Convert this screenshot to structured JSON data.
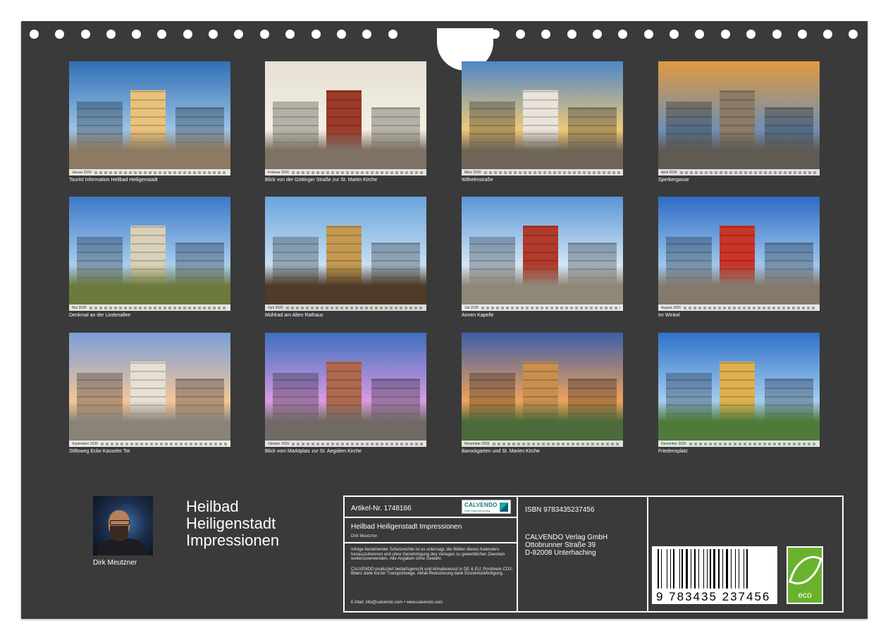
{
  "photos": [
    {
      "caption": "Tourist Information Heilbad Heiligenstadt",
      "month": "Januar 2026",
      "sky": [
        "#2f6fb4",
        "#9cc3e6"
      ],
      "ground": "#8d7a62",
      "accent": "#e8c27a"
    },
    {
      "caption": "Blick von der Göttinger Straße zur St. Martin Kirche",
      "month": "Februar 2026",
      "sky": [
        "#e6e1d2",
        "#f3efe2"
      ],
      "ground": "#7d7264",
      "accent": "#9b3b2a"
    },
    {
      "caption": "Wilhelmstraße",
      "month": "März 2026",
      "sky": [
        "#4d87c9",
        "#f0c878"
      ],
      "ground": "#6f6658",
      "accent": "#e9e3da"
    },
    {
      "caption": "Sperbergasse",
      "month": "April 2026",
      "sky": [
        "#e09a3e",
        "#6f8fb5"
      ],
      "ground": "#5f5a52",
      "accent": "#8b7b68"
    },
    {
      "caption": "Denkmal an der Lindenallee",
      "month": "Mai 2026",
      "sky": [
        "#3c78c8",
        "#a8cdee"
      ],
      "ground": "#6d7a3e",
      "accent": "#d8d0b8"
    },
    {
      "caption": "Mühlrad am Alten Rathaus",
      "month": "Juni 2026",
      "sky": [
        "#6aa5dc",
        "#c7dff2"
      ],
      "ground": "#4e3b28",
      "accent": "#c49a52"
    },
    {
      "caption": "Annen Kapelle",
      "month": "Juli 2026",
      "sky": [
        "#5a95d6",
        "#d4e6f5"
      ],
      "ground": "#8f8778",
      "accent": "#b23a2a"
    },
    {
      "caption": "Im Winkel",
      "month": "August 2026",
      "sky": [
        "#2d6cc4",
        "#9fc6ec"
      ],
      "ground": "#837a6c",
      "accent": "#c93528"
    },
    {
      "caption": "Stiftsweg Ecke Kasseler Tor",
      "month": "September 2026",
      "sky": [
        "#7a9fd8",
        "#f4c59a"
      ],
      "ground": "#8a8478",
      "accent": "#e6e0d4"
    },
    {
      "caption": "Blick vom Marktplatz zur St. Aegidien Kirche",
      "month": "Oktober 2026",
      "sky": [
        "#3e6fbf",
        "#d99be0"
      ],
      "ground": "#6f6a64",
      "accent": "#b06850"
    },
    {
      "caption": "Barockgarten und St. Marien Kirche",
      "month": "November 2026",
      "sky": [
        "#3c5ea8",
        "#f0a25a"
      ],
      "ground": "#4c6a3a",
      "accent": "#c98f4e"
    },
    {
      "caption": "Friedensplatz",
      "month": "Dezember 2026",
      "sky": [
        "#2f72c8",
        "#a4cdf0"
      ],
      "ground": "#4f7a3a",
      "accent": "#e0b050"
    }
  ],
  "author": {
    "name": "Dirk Meutzner"
  },
  "title": "Heilbad\nHeiligenstadt\nImpressionen",
  "info": {
    "article": "Artikel-Nr. 1748166",
    "logo_name": "CALVENDO",
    "logo_sub": "Dein Kalenderverlag",
    "calendar_title": "Heilbad Heiligenstadt Impressionen",
    "calendar_author": "Dirk Meutzner",
    "legal1": "Infolge bestehender Schutzrechte ist es untersagt, die Blätter dieses Kalenders herauszutrennen und ohne Genehmigung des Verlages zu gewerblichen Zwecken weiterzuverwenden. Alle Angaben ohne Gewähr.",
    "legal2": "CALVENDO produziert bedarfsgerecht und klimabewusst in DE & EU. Positivere CO2-Bilanz dank kurzer Transportwege. Abfall-Reduzierung dank Einzelstückfertigung.",
    "contact": "E-Mail: info@calvendo.com • www.calvendo.com",
    "isbn": "ISBN 9783435237456",
    "publisher": "CALVENDO Verlag GmbH\nOttobrunner Straße 39\nD-82008 Unterhaching",
    "barcode_text": "9 783435 237456",
    "eco": "eco"
  }
}
